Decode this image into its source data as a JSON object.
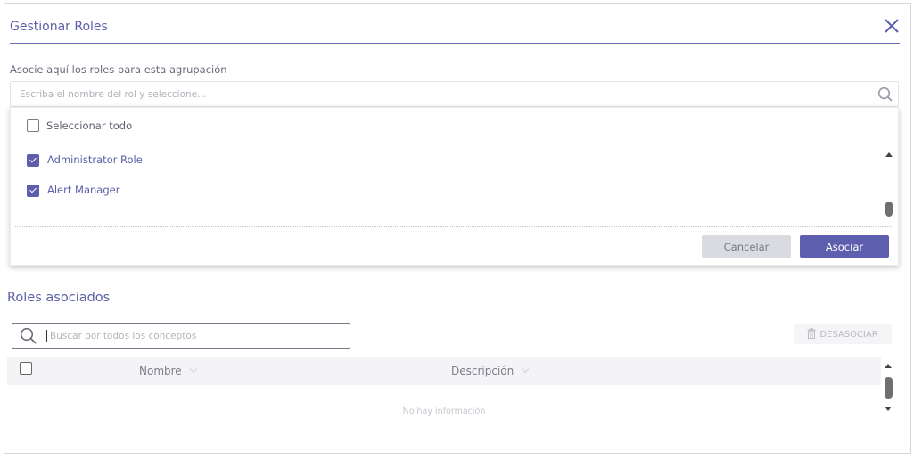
{
  "dialog": {
    "title": "Gestionar Roles",
    "close_icon": "close-icon"
  },
  "associate": {
    "label": "Asocie aquí los roles para esta agrupación",
    "search_placeholder": "Escriba el nombre del rol y seleccione...",
    "search_icon": "search-icon",
    "select_all_label": "Seleccionar todo",
    "select_all_checked": false,
    "roles": [
      {
        "label": "Administrator Role",
        "checked": true
      },
      {
        "label": "Alert Manager",
        "checked": true
      }
    ],
    "cancel_label": "Cancelar",
    "associate_label": "Asociar"
  },
  "associated_roles": {
    "title": "Roles asociados",
    "filter_placeholder": "Buscar por todos los conceptos",
    "disassociate_label": "DESASOCIAR",
    "columns": [
      "Nombre",
      "Descripción"
    ],
    "empty_text": "No hay información",
    "rows": []
  },
  "colors": {
    "accent": "#5d5fae",
    "title_text": "#5b5fa8",
    "cancel_bg": "#d9dbe0"
  }
}
